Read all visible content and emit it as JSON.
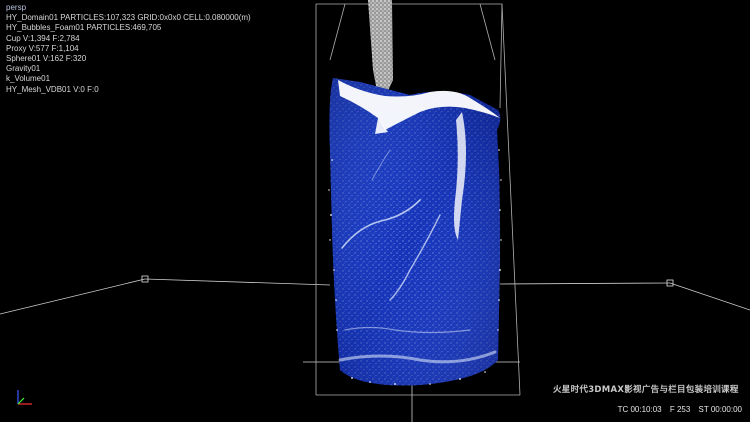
{
  "viewport": {
    "view_label": "persp",
    "stats": [
      "HY_Domain01 PARTICLES:107,323 GRID:0x0x0 CELL:0.080000(m)",
      "HY_Bubbles_Foam01 PARTICLES:469,705",
      "Cup V:1,394 F:2,784",
      "Proxy V:577 F:1,104",
      "Sphere01 V:162 F:320",
      "Gravity01",
      "k_Volume01",
      "HY_Mesh_VDB01 V:0 F:0"
    ]
  },
  "watermark": "火星时代3DMAX影视广告与栏目包装培训课程",
  "timecode": {
    "tc": "TC 00:10:03",
    "frame": "F 253",
    "st": "ST 00:00:00"
  },
  "colors": {
    "background": "#000000",
    "fluid_blue": "#1f3fc4",
    "foam_white": "#ffffff",
    "grid_line": "#d0d0d0"
  },
  "icons": {
    "axis_gizmo": "axis-tripod-icon"
  }
}
